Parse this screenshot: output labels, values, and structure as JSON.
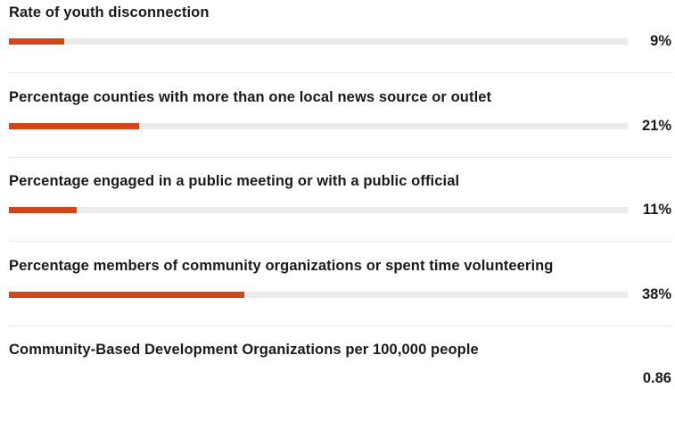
{
  "chart_data": {
    "type": "bar",
    "orientation": "horizontal",
    "bar_color": "#d2461c",
    "track_color": "#ebebeb",
    "categories": [
      "Rate of youth disconnection",
      "Percentage counties with more than one local news source or outlet",
      "Percentage engaged in a public meeting or with a public official",
      "Percentage members of community organizations or spent time volunteering",
      "Community-Based Development Organizations per 100,000 people"
    ],
    "values": [
      9,
      21,
      11,
      38,
      0.86
    ],
    "value_labels": [
      "9%",
      "21%",
      "11%",
      "38%",
      "0.86"
    ],
    "show_bar": [
      true,
      true,
      true,
      true,
      false
    ],
    "xlim": [
      0,
      100
    ]
  }
}
